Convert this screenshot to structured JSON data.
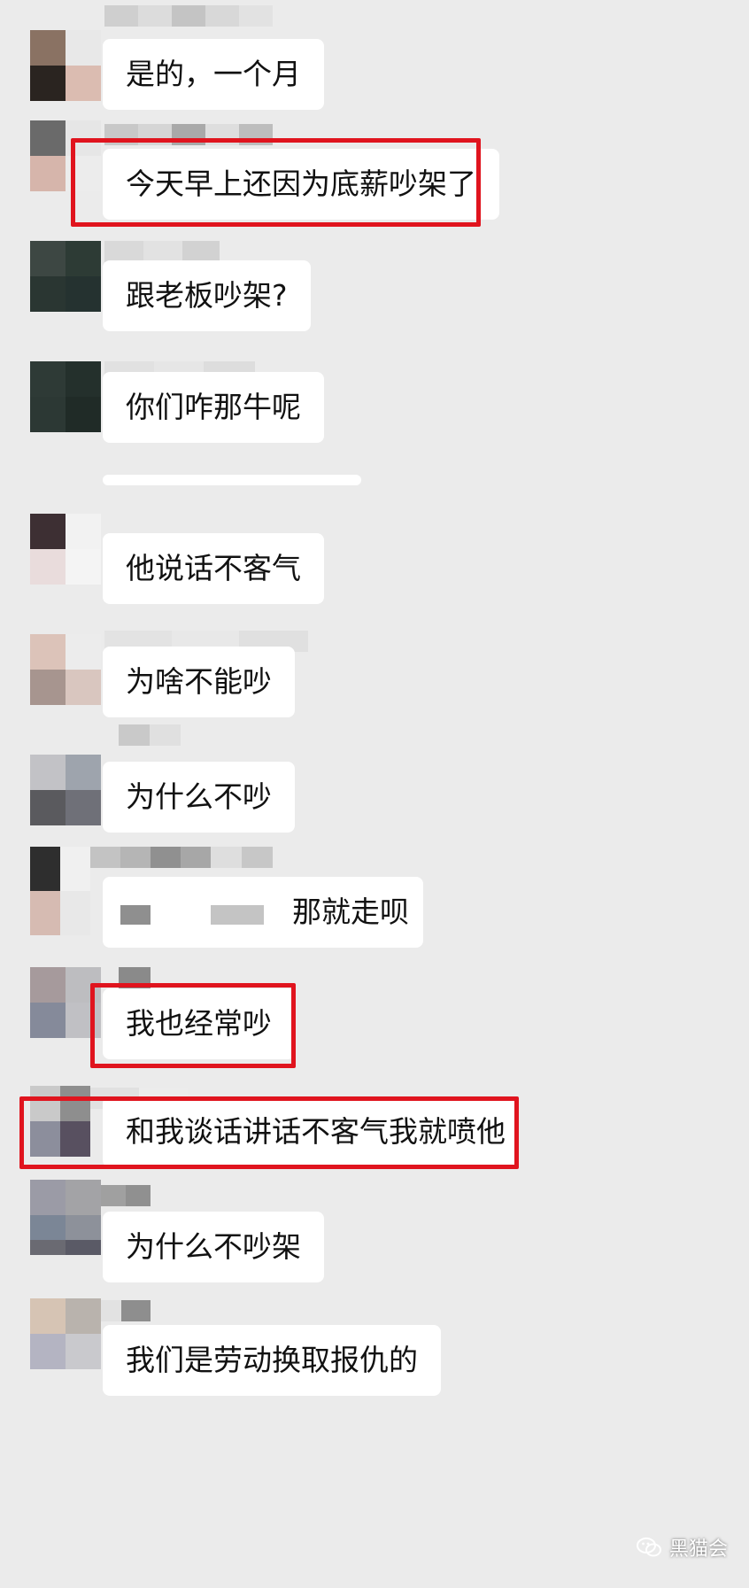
{
  "messages": [
    {
      "text": "是的，一个月"
    },
    {
      "text": "今天早上还因为底薪吵架了"
    },
    {
      "text": "跟老板吵架?"
    },
    {
      "text": "你们咋那牛呢"
    },
    {
      "text": "他说话不客气"
    },
    {
      "text": "为啥不能吵"
    },
    {
      "text": "为什么不吵"
    },
    {
      "text": "那就走呗"
    },
    {
      "text": "我也经常吵"
    },
    {
      "text": "和我谈话讲话不客气我就喷他"
    },
    {
      "text": "为什么不吵架"
    },
    {
      "text": "我们是劳动换取报仇的"
    }
  ],
  "watermark": {
    "text": "黑猫会",
    "icon": "wechat-icon"
  },
  "colors": {
    "background": "#ebebeb",
    "bubble": "#ffffff",
    "highlight": "#e0141e"
  }
}
